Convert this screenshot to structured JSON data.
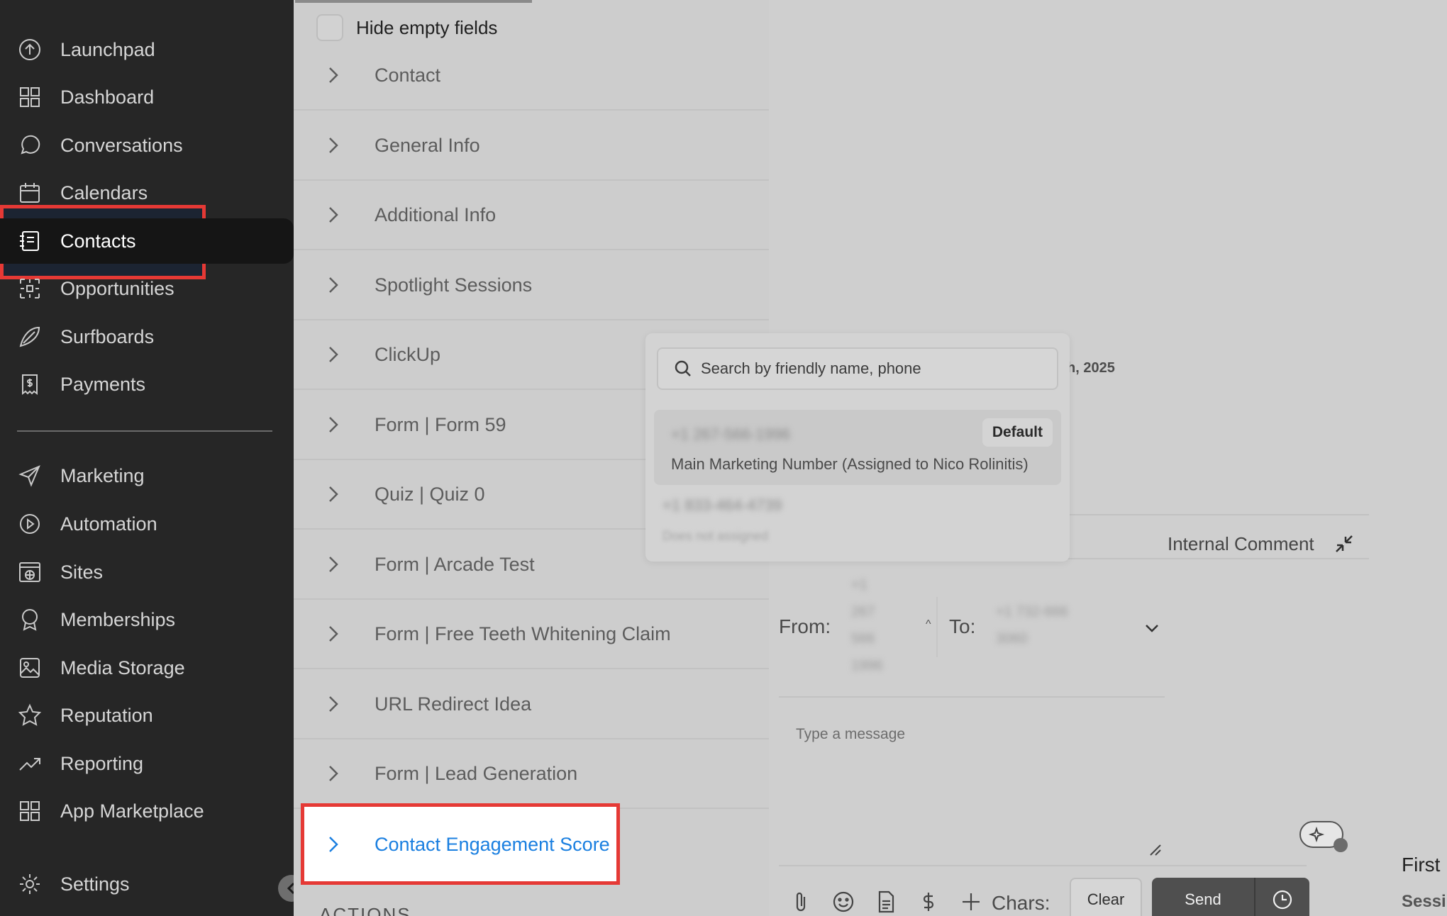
{
  "sidebar": {
    "items": [
      {
        "label": "Launchpad",
        "icon": "launchpad-icon"
      },
      {
        "label": "Dashboard",
        "icon": "dashboard-icon"
      },
      {
        "label": "Conversations",
        "icon": "chat-bubble-icon"
      },
      {
        "label": "Calendars",
        "icon": "calendar-icon"
      },
      {
        "label": "Contacts",
        "icon": "contact-card-icon"
      },
      {
        "label": "Opportunities",
        "icon": "opportunities-icon"
      },
      {
        "label": "Surfboards",
        "icon": "surfboard-icon"
      },
      {
        "label": "Payments",
        "icon": "receipt-dollar-icon"
      },
      {
        "label": "Marketing",
        "icon": "paper-plane-icon"
      },
      {
        "label": "Automation",
        "icon": "play-circle-icon"
      },
      {
        "label": "Sites",
        "icon": "globe-window-icon"
      },
      {
        "label": "Memberships",
        "icon": "badge-award-icon"
      },
      {
        "label": "Media Storage",
        "icon": "image-icon"
      },
      {
        "label": "Reputation",
        "icon": "star-icon"
      },
      {
        "label": "Reporting",
        "icon": "trend-line-icon"
      },
      {
        "label": "App Marketplace",
        "icon": "grid-icon"
      },
      {
        "label": "Settings",
        "icon": "gear-icon"
      }
    ],
    "active": "Contacts"
  },
  "details": {
    "hide_empty_label": "Hide empty fields",
    "sections": [
      "Contact",
      "General Info",
      "Additional Info",
      "Spotlight Sessions",
      "ClickUp",
      "Form | Form 59",
      "Quiz | Quiz 0",
      "Form | Arcade Test",
      "Form | Free Teeth Whitening Claim",
      "URL Redirect Idea",
      "Form | Lead Generation",
      "Contact Engagement Score"
    ],
    "actions_label": "ACTIONS"
  },
  "popup": {
    "search_placeholder": "Search by friendly name, phone",
    "item1_number": "+1 267-566-1996",
    "item1_badge": "Default",
    "item1_desc": "Main Marketing Number (Assigned to Nico Rolinitis)",
    "item2_number": "+1 833-464-4739",
    "item2_desc": "Does not assigned"
  },
  "composer": {
    "date_fragment": "h, 2025",
    "internal_comment": "Internal Comment",
    "from_label": "From:",
    "to_label": "To:",
    "from_number_blur": [
      "+1",
      "267",
      "566",
      "1996"
    ],
    "to_number_blur": [
      "+1 732-666",
      "3060"
    ],
    "message_placeholder": "Type a message",
    "chars_label": "Chars:",
    "clear_label": "Clear",
    "send_label": "Send"
  },
  "right_fragments": {
    "first": "First",
    "sess": "Sessi"
  },
  "colors": {
    "sidebar_bg": "#262626",
    "highlight_red": "#e53935",
    "link_blue": "#1a7fe0"
  }
}
